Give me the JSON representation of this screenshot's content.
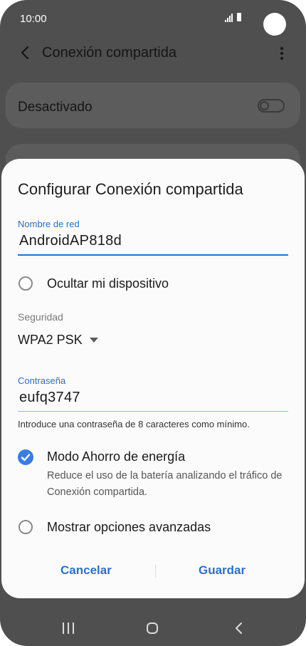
{
  "status": {
    "time": "10:00"
  },
  "appbar": {
    "title": "Conexión compartida"
  },
  "background": {
    "switch_label": "Desactivado",
    "switch_on": false
  },
  "dialog": {
    "title": "Configurar Conexión compartida",
    "network_name_label": "Nombre de red",
    "network_name_value": "AndroidAP818d",
    "hide_device_label": "Ocultar mi dispositivo",
    "hide_device_checked": false,
    "security_label": "Seguridad",
    "security_value": "WPA2 PSK",
    "password_label": "Contraseña",
    "password_value": "eufq3747",
    "password_hint": "Introduce una contraseña de 8 caracteres como mínimo.",
    "power_saving_label": "Modo Ahorro de energía",
    "power_saving_checked": true,
    "power_saving_desc": "Reduce el uso de la batería analizando el tráfico de Conexión compartida.",
    "advanced_label": "Mostrar opciones avanzadas",
    "advanced_checked": false,
    "cancel_label": "Cancelar",
    "save_label": "Guardar"
  },
  "colors": {
    "accent": "#2b6fc3",
    "check": "#3d7de0",
    "dim_bg": "#4f4f4f"
  },
  "icons": [
    "signal-icon",
    "battery-icon",
    "camera-cutout",
    "back-arrow-icon",
    "more-vert-icon",
    "dropdown-caret-icon",
    "checkmark-icon",
    "nav-recent-icon",
    "nav-home-icon",
    "nav-back-icon"
  ]
}
